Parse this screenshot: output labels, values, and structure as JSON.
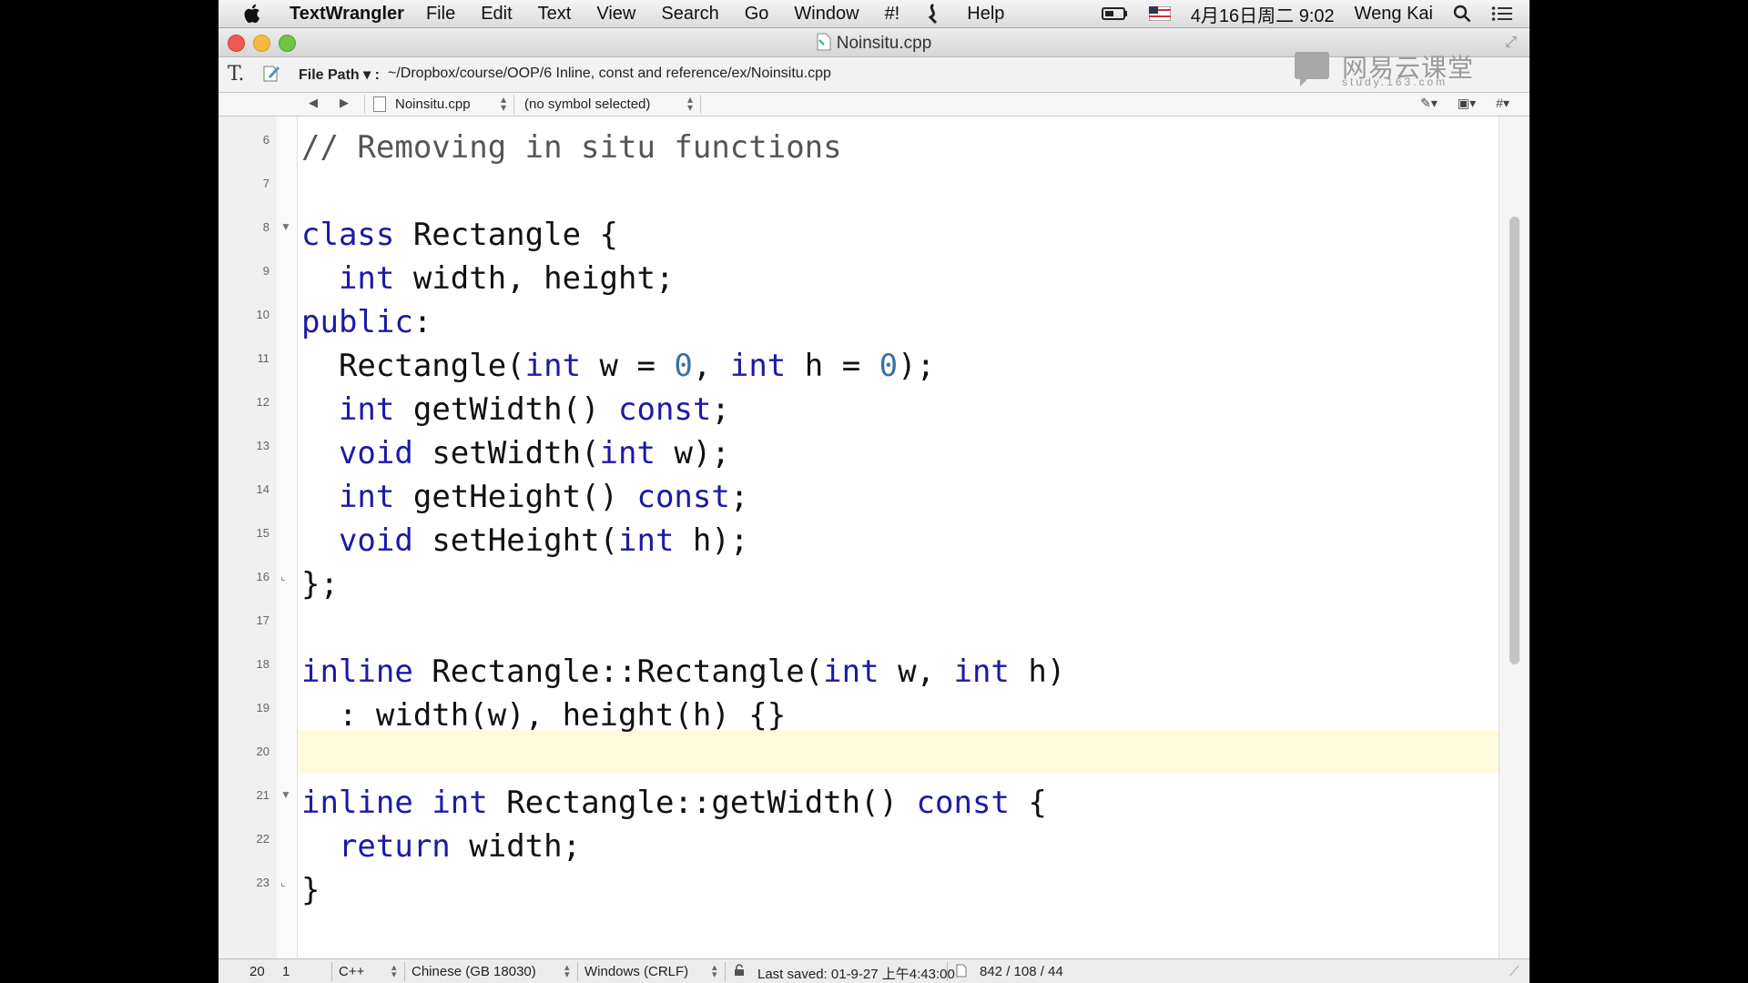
{
  "menubar": {
    "app_name": "TextWrangler",
    "items": [
      "File",
      "Edit",
      "Text",
      "View",
      "Search",
      "Go",
      "Window",
      "#!",
      "Help"
    ],
    "clock": "4月16日周二  9:02",
    "user": "Weng Kai"
  },
  "window": {
    "title": "Noinsitu.cpp"
  },
  "pathbar": {
    "label": "File Path ▾ :",
    "path": "~/Dropbox/course/OOP/6 Inline, const and reference/ex/Noinsitu.cpp"
  },
  "watermark": {
    "main": "网易云课堂",
    "sub": "study.163.com"
  },
  "navbar": {
    "file": "Noinsitu.cpp",
    "symbol": "(no symbol selected)"
  },
  "editor": {
    "line_numbers": [
      "6",
      "7",
      "8",
      "9",
      "10",
      "11",
      "12",
      "13",
      "14",
      "15",
      "16",
      "17",
      "18",
      "19",
      "20",
      "21",
      "22",
      "23"
    ],
    "current_line": "20"
  },
  "status": {
    "line": "20",
    "col": "1",
    "language": "C++",
    "encoding": "Chinese (GB 18030)",
    "line_endings": "Windows (CRLF)",
    "last_saved": "Last saved: 01-9-27 上午4:43:00",
    "counts": "842 / 108 / 44"
  }
}
